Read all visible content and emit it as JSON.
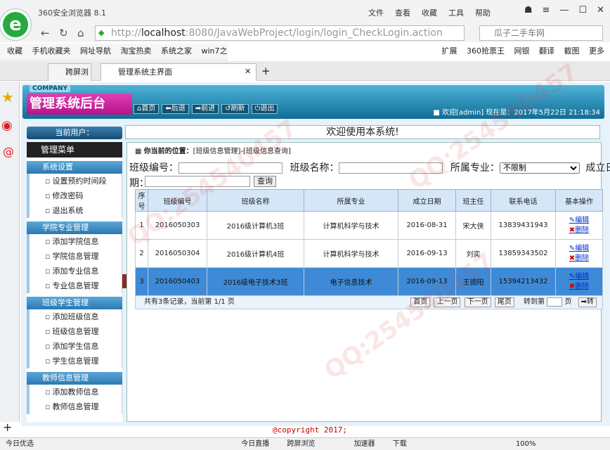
{
  "browser": {
    "name": "360安全浏览器 8.1",
    "menu": [
      "文件",
      "查看",
      "收藏",
      "工具",
      "帮助"
    ],
    "url_host": "localhost",
    "url_rest": ":8080/JavaWebProject/login/login_CheckLogin.action",
    "url_prefix": "http://",
    "search_placeholder": "瓜子二手车网",
    "bookmarks": [
      "收藏",
      "手机收藏夹",
      "网址导航",
      "淘宝热卖",
      "系统之家",
      "win7之"
    ],
    "bookmarks_right": [
      "扩展",
      "360抢票王",
      "网银",
      "翻译",
      "截图",
      "更多"
    ],
    "tabs": [
      "跨屏浏览",
      "管理系统主界面"
    ]
  },
  "app": {
    "company": "COMPANY",
    "title": "管理系统后台",
    "nav": [
      "首页",
      "后退",
      "前进",
      "刷新",
      "退出"
    ],
    "welcome": "欢迎[admin]   现在是：2017年5月22日 21:18:34",
    "current_user": "当前用户：",
    "main_header": "欢迎使用本系统!",
    "menu_title": "管理菜单",
    "groups": [
      {
        "title": "系统设置",
        "items": [
          "设置预约时间段",
          "修改密码",
          "退出系统"
        ]
      },
      {
        "title": "学院专业管理",
        "items": [
          "添加学院信息",
          "学院信息管理",
          "添加专业信息",
          "专业信息管理"
        ]
      },
      {
        "title": "班级学生管理",
        "items": [
          "添加班级信息",
          "班级信息管理",
          "添加学生信息",
          "学生信息管理"
        ]
      },
      {
        "title": "教师信息管理",
        "items": [
          "添加教师信息",
          "教师信息管理"
        ]
      }
    ],
    "position_label": "你当前的位置：",
    "position_value": "[班级信息管理]-[班级信息查询]",
    "search": {
      "class_no_label": "班级编号：",
      "class_name_label": "班级名称：",
      "major_label": "所属专业：",
      "major_value": "不限制",
      "date_label_1": "成立日",
      "date_label_2": "期：",
      "query_btn": "查询"
    },
    "table": {
      "headers": [
        "序号",
        "班级编号",
        "班级名称",
        "所属专业",
        "成立日期",
        "班主任",
        "联系电话",
        "基本操作"
      ],
      "rows": [
        [
          "1",
          "2016050303",
          "2016级计算机3班",
          "计算机科学与技术",
          "2016-08-31",
          "宋大侠",
          "13839431943"
        ],
        [
          "2",
          "2016050304",
          "2016级计算机4班",
          "计算机科学与技术",
          "2016-09-13",
          "刘奕",
          "13859343502"
        ],
        [
          "3",
          "2016050403",
          "2016级电子技术3班",
          "电子信息技术",
          "2016-09-13",
          "王德阳",
          "15394213432"
        ]
      ],
      "edit": "编辑",
      "delete": "删除",
      "selected_row": 3
    },
    "pager": {
      "summary": "共有3条记录，当前第 1/1 页",
      "buttons": [
        "首页",
        "上一页",
        "下一页",
        "尾页"
      ],
      "goto": "转到第",
      "page": "页",
      "go": "转"
    },
    "copyright": "@copyright 2017;"
  },
  "statusbar": [
    "今日优选",
    "今日直播",
    "跨屏浏览",
    "加速器",
    "下载",
    "100%"
  ],
  "watermark": "QQ:254540457"
}
